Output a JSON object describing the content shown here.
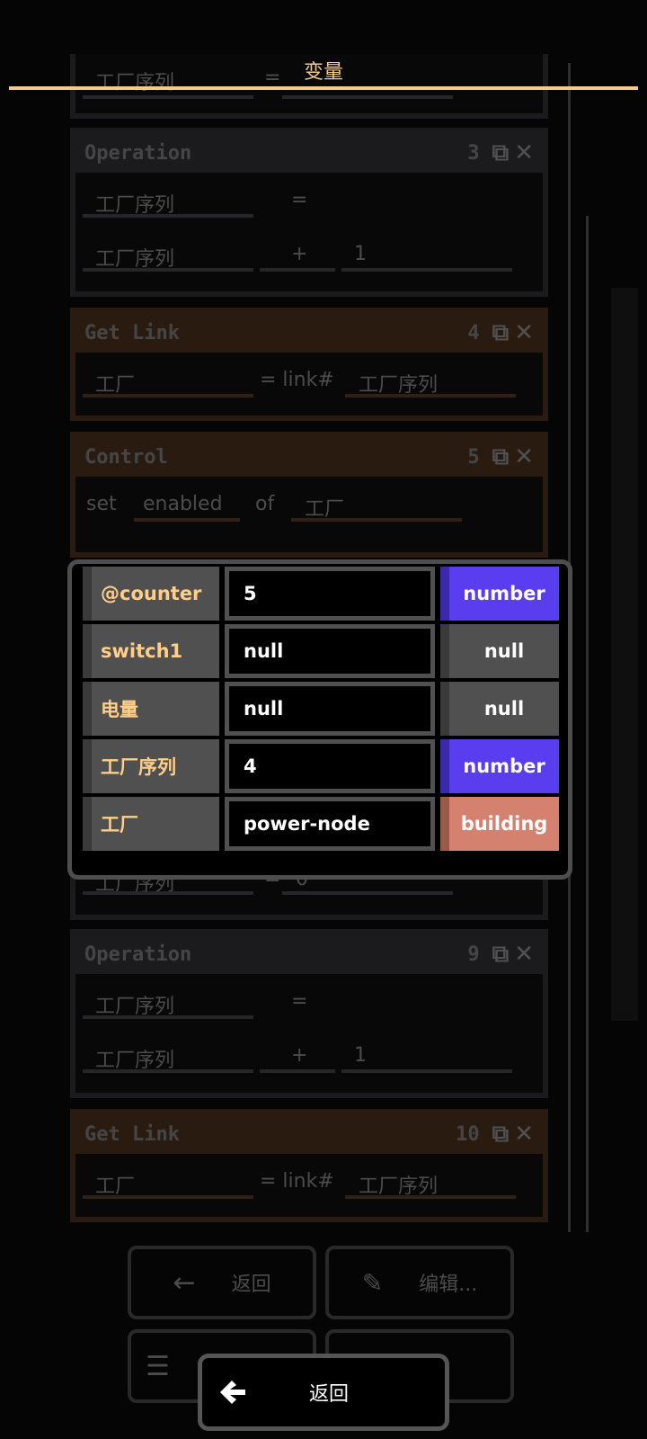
{
  "header": {
    "title": "变量"
  },
  "dialog": {
    "variables": [
      {
        "name": "@counter",
        "value": "5",
        "type": "number"
      },
      {
        "name": "switch1",
        "value": "null",
        "type": "null"
      },
      {
        "name": "电量",
        "value": "null",
        "type": "null"
      },
      {
        "name": "工厂序列",
        "value": "4",
        "type": "number"
      },
      {
        "name": "工厂",
        "value": "power-node",
        "type": "building"
      }
    ],
    "back_label": "返回"
  },
  "background": {
    "blocks": [
      {
        "title": "Operation",
        "number": "3",
        "lines": [
          [
            "工厂序列",
            "="
          ],
          [
            "工厂序列",
            "+",
            "1"
          ]
        ]
      },
      {
        "title": "Get Link",
        "number": "4",
        "lines": [
          [
            "工厂",
            "= link#",
            "工厂序列"
          ]
        ]
      },
      {
        "title": "Control",
        "number": "5",
        "lines": [
          [
            "set",
            "enabled",
            "of",
            "工厂"
          ]
        ]
      },
      {
        "title": "Operation",
        "number": "9",
        "lines": [
          [
            "工厂序列",
            "="
          ],
          [
            "工厂序列",
            "+",
            "1"
          ]
        ]
      },
      {
        "title": "Get Link",
        "number": "10",
        "lines": [
          [
            "工厂",
            "= link#",
            "工厂序列"
          ]
        ]
      }
    ],
    "partial_rows": [
      [
        "工厂序列",
        "="
      ],
      [
        "工厂序列",
        "=",
        "0"
      ]
    ],
    "buttons": {
      "back": "返回",
      "edit": "编辑..."
    }
  }
}
